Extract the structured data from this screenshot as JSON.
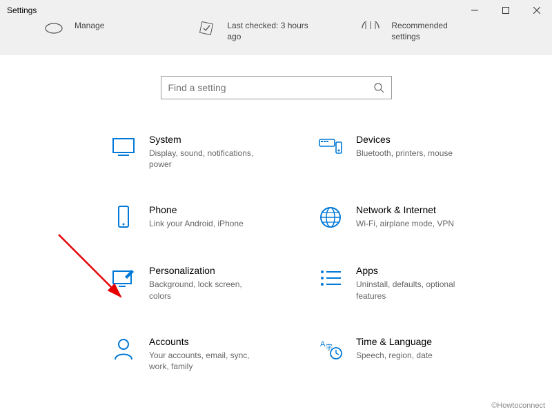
{
  "window": {
    "title": "Settings"
  },
  "topband": {
    "manage_label": "Manage",
    "last_checked_label": "Last checked: 3 hours ago",
    "recommended_label": "Recommended settings"
  },
  "search": {
    "placeholder": "Find a setting"
  },
  "categories": {
    "system": {
      "title": "System",
      "desc": "Display, sound, notifications, power"
    },
    "devices": {
      "title": "Devices",
      "desc": "Bluetooth, printers, mouse"
    },
    "phone": {
      "title": "Phone",
      "desc": "Link your Android, iPhone"
    },
    "network": {
      "title": "Network & Internet",
      "desc": "Wi-Fi, airplane mode, VPN"
    },
    "personal": {
      "title": "Personalization",
      "desc": "Background, lock screen, colors"
    },
    "apps": {
      "title": "Apps",
      "desc": "Uninstall, defaults, optional features"
    },
    "accounts": {
      "title": "Accounts",
      "desc": "Your accounts, email, sync, work, family"
    },
    "time": {
      "title": "Time & Language",
      "desc": "Speech, region, date"
    }
  },
  "watermark": "©Howtoconnect",
  "colors": {
    "accent": "#0078D7"
  }
}
